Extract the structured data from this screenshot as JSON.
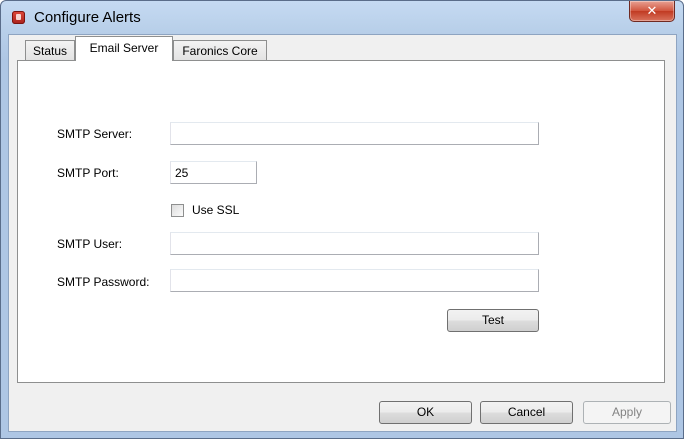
{
  "window": {
    "title": "Configure Alerts",
    "close_glyph": "✕"
  },
  "tabs": [
    {
      "label": "Status",
      "active": false
    },
    {
      "label": "Email Server",
      "active": true
    },
    {
      "label": "Faronics Core",
      "active": false
    }
  ],
  "form": {
    "smtp_server_label": "SMTP Server:",
    "smtp_server_value": "",
    "smtp_port_label": "SMTP Port:",
    "smtp_port_value": "25",
    "use_ssl_label": "Use SSL",
    "use_ssl_checked": false,
    "smtp_user_label": "SMTP User:",
    "smtp_user_value": "",
    "smtp_password_label": "SMTP Password:",
    "smtp_password_value": "",
    "test_label": "Test"
  },
  "footer": {
    "ok_label": "OK",
    "cancel_label": "Cancel",
    "apply_label": "Apply",
    "apply_enabled": false
  },
  "icons": {
    "app": "faronics-alert-icon",
    "close": "close-icon",
    "checkbox": "checkbox-icon"
  },
  "colors": {
    "close_button": "#c13a22",
    "title_bar": "#c5daf2",
    "client_bg": "#f0f0f0"
  }
}
